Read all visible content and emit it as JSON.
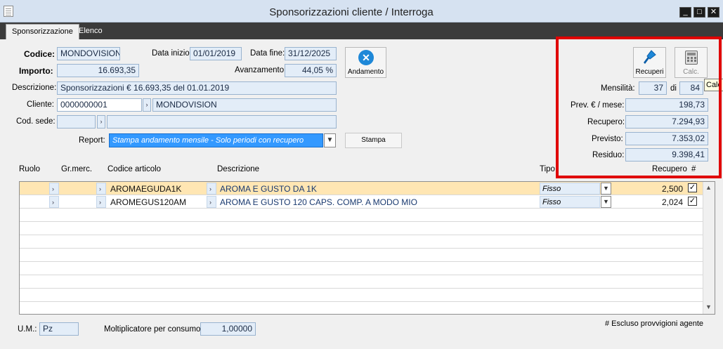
{
  "window": {
    "title": "Sponsorizzazioni cliente / Interroga",
    "controls": {
      "minimize": "_",
      "maximize": "□",
      "close": "✕"
    }
  },
  "tabs": [
    "Sponsorizzazione",
    "Elenco"
  ],
  "form": {
    "codice_label": "Codice:",
    "codice": "MONDOVISION",
    "data_inizio_label": "Data inizio:",
    "data_inizio": "01/01/2019",
    "data_fine_label": "Data fine:",
    "data_fine": "31/12/2025",
    "importo_label": "Importo:",
    "importo": "16.693,35",
    "avanzamento_label": "Avanzamento:",
    "avanzamento": "44,05 %",
    "descrizione_label": "Descrizione:",
    "descrizione": "Sponsorizzazioni € 16.693,35 del 01.01.2019",
    "cliente_label": "Cliente:",
    "cliente_code": "0000000001",
    "cliente_name": "MONDOVISION",
    "cod_sede_label": "Cod. sede:",
    "cod_sede": "",
    "cod_sede_desc": "",
    "report_label": "Report:",
    "report_value": "Stampa andamento mensile - Solo periodi con recupero",
    "stampa_button": "Stampa",
    "andamento_button": "Andamento"
  },
  "panel": {
    "recuperi_button": "Recuperi",
    "calc_button": "Calc.",
    "tooltip": "Calc",
    "mensilita_label": "Mensilità:",
    "mensilita": "37",
    "di_label": "di",
    "mensilita_tot": "84",
    "prev_label": "Prev. € / mese:",
    "prev": "198,73",
    "recupero_label": "Recupero:",
    "recupero": "7.294,93",
    "previsto_label": "Previsto:",
    "previsto": "7.353,02",
    "residuo_label": "Residuo:",
    "residuo": "9.398,41"
  },
  "grid": {
    "headers": {
      "ruolo": "Ruolo",
      "grmerc": "Gr.merc.",
      "codice": "Codice articolo",
      "descrizione": "Descrizione",
      "tipo": "Tipo",
      "recupero": "Recupero",
      "hash": "#"
    },
    "rows": [
      {
        "codice": "AROMAEGUDA1K",
        "descrizione": "AROMA E GUSTO DA 1K",
        "tipo": "Fisso",
        "recupero": "2,500",
        "checked": "✓"
      },
      {
        "codice": "AROMEGUS120AM",
        "descrizione": "AROMA E GUSTO 120 CAPS. COMP. A MODO MIO",
        "tipo": "Fisso",
        "recupero": "2,024",
        "checked": "✓"
      }
    ]
  },
  "footer": {
    "um_label": "U.M.:",
    "um": "Pz",
    "molt_label": "Moltiplicatore per consumo:",
    "molt": "1,00000",
    "note": "# Escluso provvigioni agente"
  },
  "colors": {
    "highlight": "#e00000",
    "selected_row": "#ffe6b3",
    "field_bg": "#e3edf8"
  }
}
